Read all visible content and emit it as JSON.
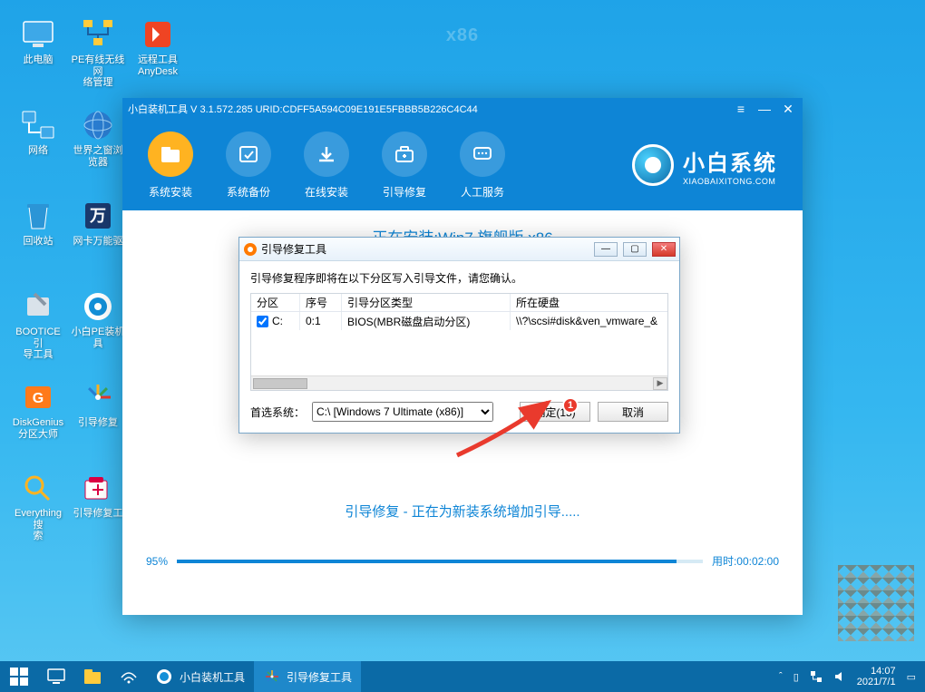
{
  "watermark": "x86",
  "desktop_icons": [
    {
      "label": "此电脑",
      "icon": "pc"
    },
    {
      "label": "PE有线无线网\n络管理",
      "icon": "net"
    },
    {
      "label": "远程工具\nAnyDesk",
      "icon": "anydesk"
    },
    {
      "label": "网络",
      "icon": "network"
    },
    {
      "label": "世界之窗浏\n览器",
      "icon": "globe"
    },
    {
      "label": "回收站",
      "icon": "trash"
    },
    {
      "label": "网卡万能驱",
      "icon": "driver"
    },
    {
      "label": "BOOTICE引\n导工具",
      "icon": "bootice"
    },
    {
      "label": "小白PE装机\n具",
      "icon": "xiaobai"
    },
    {
      "label": "DiskGenius\n分区大师",
      "icon": "diskgenius"
    },
    {
      "label": "引导修复",
      "icon": "bootfix"
    },
    {
      "label": "Everything搜\n索",
      "icon": "everything"
    },
    {
      "label": "引导修复工",
      "icon": "bootfix2"
    }
  ],
  "app": {
    "title": "小白装机工具 V 3.1.572.285 URID:CDFF5A594C09E191E5FBBB5B226C4C44",
    "tabs": [
      {
        "label": "系统安装",
        "icon": "folder"
      },
      {
        "label": "系统备份",
        "icon": "backup"
      },
      {
        "label": "在线安装",
        "icon": "download"
      },
      {
        "label": "引导修复",
        "icon": "case"
      },
      {
        "label": "人工服务",
        "icon": "chat"
      }
    ],
    "brand": {
      "big": "小白系统",
      "small": "XIAOBAIXITONG.COM"
    },
    "status1": "正在安装:Win7 旗舰版 x86",
    "status2": "引导修复 - 正在为新装系统增加引导.....",
    "progress": {
      "pct": 95,
      "pct_label": "95%",
      "time_label": "用时:00:02:00"
    }
  },
  "dlg": {
    "title": "引导修复工具",
    "msg": "引导修复程序即将在以下分区写入引导文件，请您确认。",
    "headers": {
      "c1": "分区",
      "c2": "序号",
      "c3": "引导分区类型",
      "c4": "所在硬盘"
    },
    "rows": [
      {
        "checked": true,
        "c1": "C:",
        "c2": "0:1",
        "c3": "BIOS(MBR磁盘启动分区)",
        "c4": "\\\\?\\scsi#disk&ven_vmware_&"
      }
    ],
    "select_label": "首选系统：",
    "select_value": "C:\\ [Windows 7 Ultimate (x86)]",
    "ok_label": "确定(15)",
    "cancel_label": "取消"
  },
  "annotation": {
    "badge": "1"
  },
  "taskbar": {
    "items": [
      {
        "label": "小白装机工具",
        "icon": "xiaobai",
        "active": false
      },
      {
        "label": "引导修复工具",
        "icon": "bootfix",
        "active": true
      }
    ],
    "time": "14:07",
    "date": "2021/7/1"
  }
}
